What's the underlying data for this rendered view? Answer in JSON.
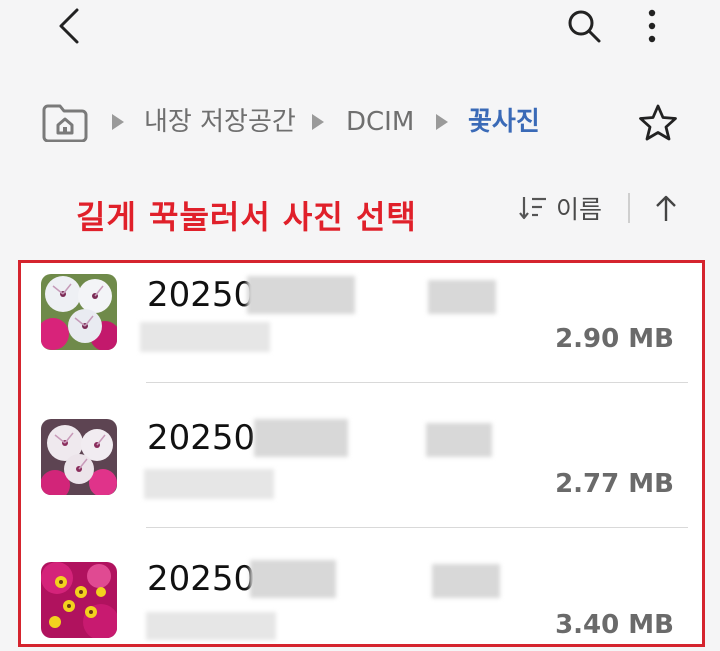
{
  "breadcrumb": {
    "items": [
      {
        "label": "내장 저장공간"
      },
      {
        "label": "DCIM"
      },
      {
        "label": "꽃사진"
      }
    ]
  },
  "annotation": "길게 꾹눌러서 사진 선택",
  "sort": {
    "label": "이름"
  },
  "files": [
    {
      "name": "20250",
      "size": "2.90 MB"
    },
    {
      "name": "20250",
      "size": "2.77 MB"
    },
    {
      "name": "20250",
      "size": "3.40 MB"
    }
  ],
  "icons": {
    "back": "chevron-left-icon",
    "search": "search-icon",
    "more": "more-vert-icon",
    "home": "home-folder-icon",
    "star": "star-icon",
    "sort": "sort-icon",
    "sort_direction": "arrow-up-icon"
  },
  "colors": {
    "accent_breadcrumb": "#3a6ab7",
    "annotation_red": "#e0202a",
    "frame_red": "#d5242e"
  }
}
